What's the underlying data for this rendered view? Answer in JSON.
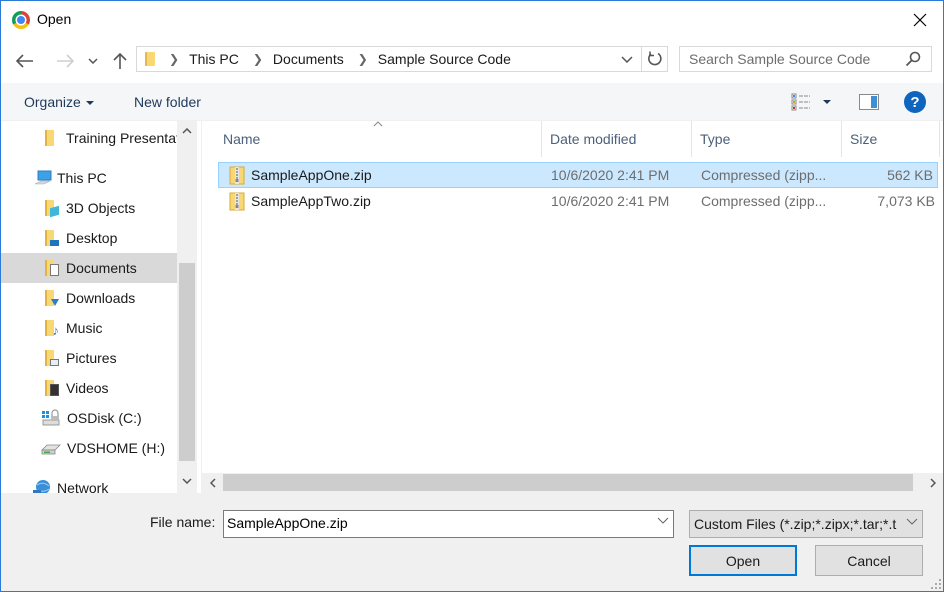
{
  "window": {
    "title": "Open",
    "app_icon": "chrome-icon"
  },
  "nav": {
    "back": "back-arrow-icon",
    "forward": "forward-arrow-icon",
    "recent": "chevron-down-icon",
    "up": "up-arrow-icon",
    "breadcrumbs": [
      "This PC",
      "Documents",
      "Sample Source Code"
    ],
    "search_placeholder": "Search Sample Source Code"
  },
  "toolbar": {
    "organize_label": "Organize",
    "new_folder_label": "New folder",
    "help_label": "?"
  },
  "sidebar": {
    "items": [
      {
        "label": "Training Presentations",
        "icon": "folder-icon",
        "indent": 2
      },
      {
        "label": "This PC",
        "icon": "computer-icon",
        "indent": 1
      },
      {
        "label": "3D Objects",
        "icon": "3d-objects-folder-icon",
        "indent": 2
      },
      {
        "label": "Desktop",
        "icon": "desktop-folder-icon",
        "indent": 2
      },
      {
        "label": "Documents",
        "icon": "documents-folder-icon",
        "indent": 2,
        "selected": true
      },
      {
        "label": "Downloads",
        "icon": "downloads-folder-icon",
        "indent": 2
      },
      {
        "label": "Music",
        "icon": "music-folder-icon",
        "indent": 2
      },
      {
        "label": "Pictures",
        "icon": "pictures-folder-icon",
        "indent": 2
      },
      {
        "label": "Videos",
        "icon": "videos-folder-icon",
        "indent": 2
      },
      {
        "label": "OSDisk (C:)",
        "icon": "system-drive-icon",
        "indent": 2
      },
      {
        "label": "VDSHOME (H:)",
        "icon": "network-drive-icon",
        "indent": 2
      },
      {
        "label": "Network",
        "icon": "network-icon",
        "indent": 1
      }
    ]
  },
  "filelist": {
    "columns": [
      "Name",
      "Date modified",
      "Type",
      "Size"
    ],
    "rows": [
      {
        "name": "SampleAppOne.zip",
        "date": "10/6/2020 2:41 PM",
        "type": "Compressed (zipp...",
        "size": "562 KB",
        "selected": true
      },
      {
        "name": "SampleAppTwo.zip",
        "date": "10/6/2020 2:41 PM",
        "type": "Compressed (zipp...",
        "size": "7,073 KB",
        "selected": false
      }
    ]
  },
  "bottom": {
    "file_name_label": "File name:",
    "file_name_value": "SampleAppOne.zip",
    "file_type_value": "Custom Files (*.zip;*.zipx;*.tar;*.t",
    "open_label": "Open",
    "cancel_label": "Cancel"
  },
  "colors": {
    "accent": "#0078d7",
    "selection_bg": "#cce8ff",
    "selection_border": "#99d1ff",
    "sidebar_selected": "#d9d9d9",
    "help_blue": "#0f64bd"
  }
}
